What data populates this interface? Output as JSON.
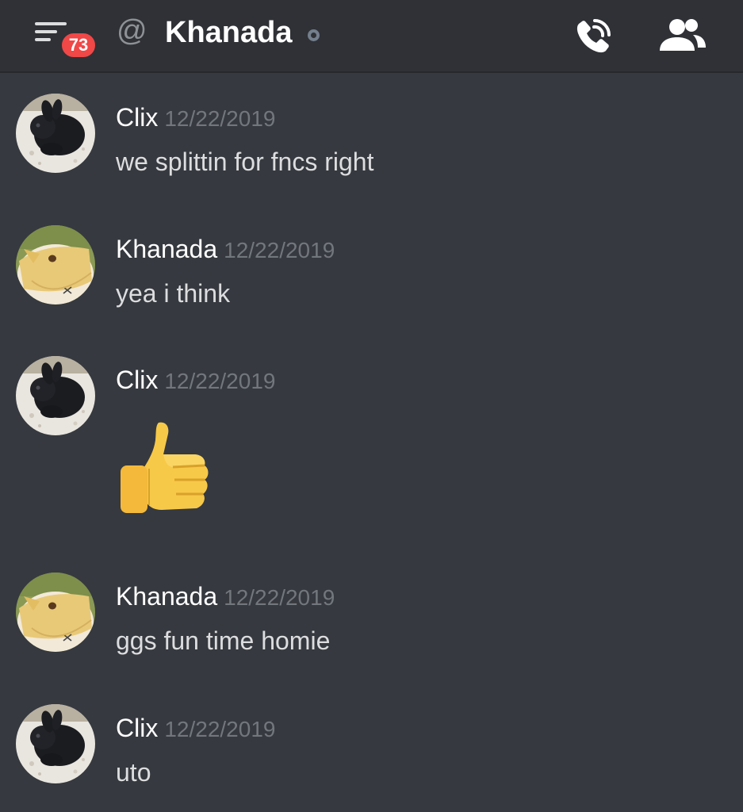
{
  "header": {
    "unread_badge": "73",
    "at_symbol": "@",
    "channel_name": "Khanada",
    "status": "offline",
    "icons": [
      "menu-icon",
      "voice-call-icon",
      "members-icon"
    ]
  },
  "colors": {
    "background": "#36393f",
    "header": "#2f3136",
    "badge": "#f04747",
    "timestamp": "#72767d"
  },
  "messages": [
    {
      "author": "Clix",
      "timestamp": "12/22/2019",
      "text": "we splittin for fncs right",
      "avatar": "clix-avatar"
    },
    {
      "author": "Khanada",
      "timestamp": "12/22/2019",
      "text": "yea i think",
      "avatar": "khanada-avatar"
    },
    {
      "author": "Clix",
      "timestamp": "12/22/2019",
      "text": "",
      "emoji": "thumbs-up",
      "avatar": "clix-avatar"
    },
    {
      "author": "Khanada",
      "timestamp": "12/22/2019",
      "text": "ggs fun time homie",
      "avatar": "khanada-avatar"
    },
    {
      "author": "Clix",
      "timestamp": "12/22/2019",
      "text": "uto",
      "avatar": "clix-avatar"
    }
  ]
}
